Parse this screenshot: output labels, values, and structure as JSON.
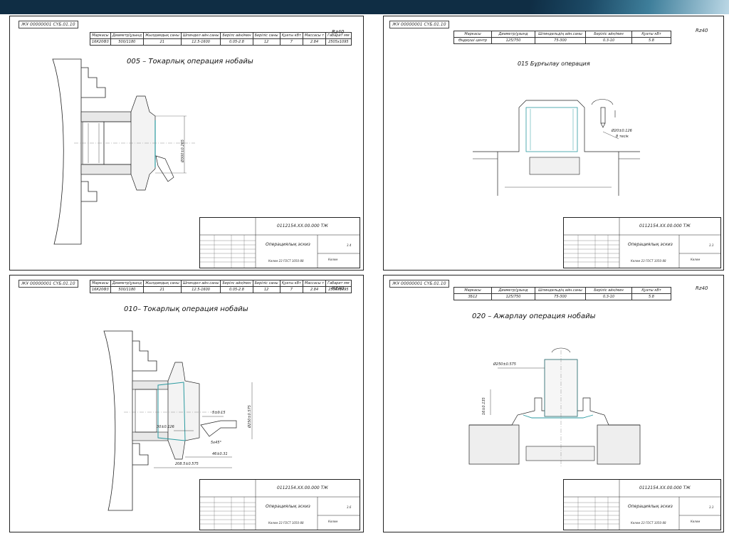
{
  "slide": {
    "colors": {
      "bar": "#0f2d44",
      "accent": "#3f7f9b"
    }
  },
  "sheets": [
    {
      "code": "ЖҰ 00000001 СҮБ.01.10",
      "params": {
        "headers": [
          "Маркасы",
          "Диаметр/ұзынд",
          "Жылдамдық саны",
          "Шпиндел айн.саны",
          "Берілс айн/мин",
          "Беріліс саны",
          "Қуаты кВт",
          "Массасы т",
          "Габарит мм"
        ],
        "values": [
          "16К20Ф3",
          "500/1180",
          "21",
          "12.5-1600",
          "0.05-2.8",
          "12",
          "7",
          "2.84",
          "2505x1095"
        ]
      },
      "title": "005 – Токарлық операция нобайы",
      "rz": "Rz40",
      "dims": [
        "Ø300±0.265"
      ],
      "stamp": {
        "doc": "0112154.XX.00.000 ТЖ",
        "card": "Операциялық эскиз",
        "gost": "Көлем 23 ГОСТ 1050-88",
        "sheet": "3.4",
        "sign": "Көлем"
      }
    },
    {
      "code": "ЖҰ 00000001 СҮБ.01.10",
      "params": {
        "headers": [
          "Маркасы",
          "Диаметр/ұзынд",
          "Шпиндельдің айн.саны",
          "Беріліс айн/мин",
          "Қуаты кВт"
        ],
        "values": [
          "Өңдеуші центр",
          "125/750",
          "75-300",
          "0.3-10",
          "5.8"
        ]
      },
      "title": "015 Бұрғылау операция",
      "rz": "Rz40",
      "dims": [
        "Ø20±0.126",
        "8 тесік"
      ],
      "stamp": {
        "doc": "0112154.XX.00.000 ТЖ",
        "card": "Операциялық эскиз",
        "gost": "Көлем 23 ГОСТ 1050-88",
        "sheet": "3.3",
        "sign": "Көлем"
      }
    },
    {
      "code": "ЖҰ 00000001 СҮБ.01.10",
      "params": {
        "headers": [
          "Маркасы",
          "Диаметр/ұзынд",
          "Жылдамдық саны",
          "Шпиндел айн.саны",
          "Берілс айн/мин",
          "Беріліс саны",
          "Қуаты кВт",
          "Массасы т",
          "Габарит мм"
        ],
        "values": [
          "16К20Ф3",
          "500/1180",
          "21",
          "12.5-1600",
          "0.05-2.8",
          "12",
          "7",
          "2.84",
          "2505x1095"
        ]
      },
      "title": "010– Токарлық операция нобайы",
      "rz": "Rz40",
      "dims": [
        "Ø250±0.575",
        "5±0.15",
        "30±0.126",
        "5x45°",
        "46±0.31",
        "208.5±0.575"
      ],
      "stamp": {
        "doc": "0112154.XX.00.000 ТЖ",
        "card": "Операциялық эскиз",
        "gost": "Көлем 23 ГОСТ 1050-88",
        "sheet": "3.6",
        "sign": "Көлем"
      }
    },
    {
      "code": "ЖҰ 00000001 СҮБ.01.10",
      "params": {
        "headers": [
          "Маркасы",
          "Диаметр/ұзынд",
          "Шпиндельдің айн.саны",
          "Беріліс айн/мин",
          "Қуаты кВт"
        ],
        "values": [
          "3Б12",
          "125/750",
          "75-300",
          "0.3-10",
          "5.8"
        ]
      },
      "title": "020 – Ажарлау операция нобайы",
      "rz": "Rz40",
      "dims": [
        "Ø250±0.575",
        "16±0.135"
      ],
      "stamp": {
        "doc": "0112154.XX.00.000 ТЖ",
        "card": "Операциялық эскиз",
        "gost": "Көлем 23 ГОСТ 1050-88",
        "sheet": "3.3",
        "sign": "Көлем"
      }
    }
  ]
}
